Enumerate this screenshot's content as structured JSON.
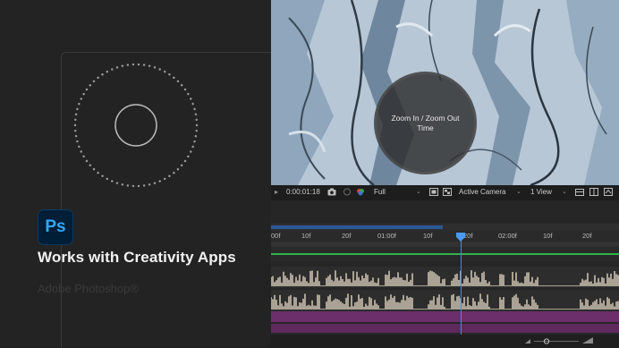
{
  "promo": {
    "app_abbrev": "Ps",
    "title": "Works with Creativity Apps",
    "faded_text": "Adobe Photoshop®"
  },
  "viewer": {
    "zoom_label": "Zoom In / Zoom Out Time"
  },
  "toolbar": {
    "timecode": "0:00:01:18",
    "resolution": "Full",
    "camera": "Active Camera",
    "view": "1 View"
  },
  "ruler": {
    "ticks": [
      "00f",
      "10f",
      "20f",
      "01:00f",
      "10f",
      "20f",
      "02:00f",
      "10f",
      "20f"
    ]
  },
  "colors": {
    "accent_blue": "#3e8ee8",
    "track_green": "#2fb34d",
    "track_purple": "#6c2f6c",
    "ps_blue": "#31a8ff"
  },
  "icons": [
    "camera-icon",
    "color-channel-icon",
    "region-icon",
    "transparency-grid-icon",
    "grid-icon",
    "3d-view-icon",
    "playhead-icon",
    "zoom-slider-icon"
  ]
}
